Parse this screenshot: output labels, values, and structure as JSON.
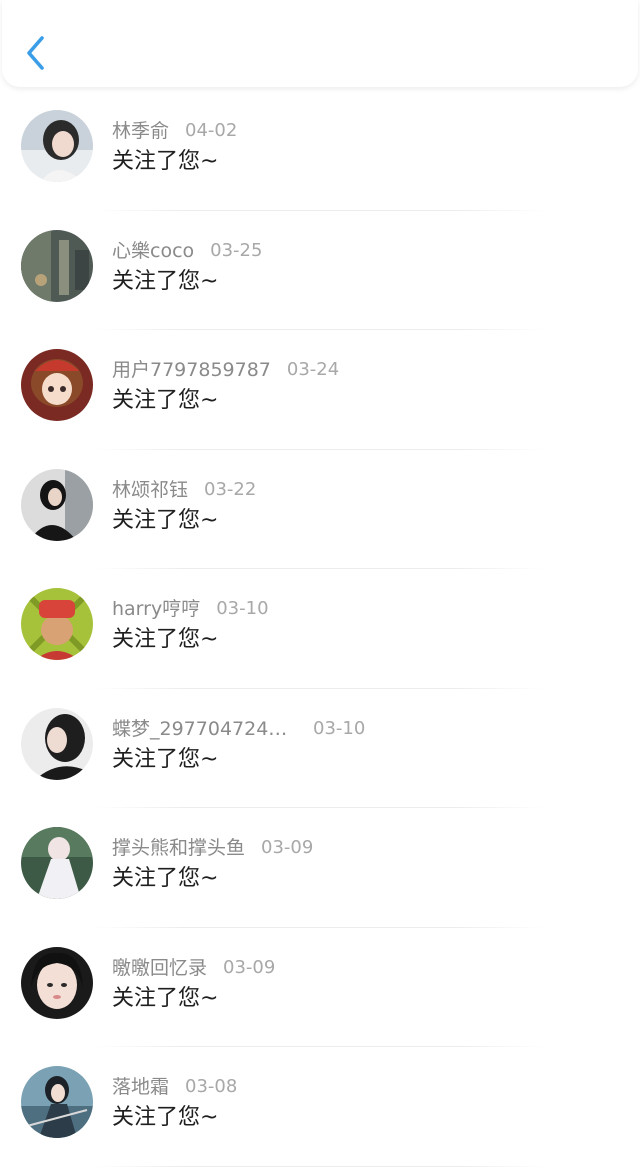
{
  "header": {
    "back_icon": "chevron-left-icon",
    "accent": "#3a9de8"
  },
  "notifications": [
    {
      "username": "林季俞",
      "date": "04-02",
      "message": "关注了您~",
      "avatar": "avatar-icon"
    },
    {
      "username": "心樂coco",
      "date": "03-25",
      "message": "关注了您~",
      "avatar": "avatar-icon"
    },
    {
      "username": "用户7797859787",
      "date": "03-24",
      "message": "关注了您~",
      "avatar": "avatar-icon"
    },
    {
      "username": "林颂祁钰",
      "date": "03-22",
      "message": "关注了您~",
      "avatar": "avatar-icon"
    },
    {
      "username": "harry哼哼",
      "date": "03-10",
      "message": "关注了您~",
      "avatar": "avatar-icon"
    },
    {
      "username": "蝶梦_2977047240...",
      "date": "03-10",
      "message": "关注了您~",
      "avatar": "avatar-icon"
    },
    {
      "username": "撑头熊和撑头鱼",
      "date": "03-09",
      "message": "关注了您~",
      "avatar": "avatar-icon"
    },
    {
      "username": "曒曒回忆录",
      "date": "03-09",
      "message": "关注了您~",
      "avatar": "avatar-icon"
    },
    {
      "username": "落地霜",
      "date": "03-08",
      "message": "关注了您~",
      "avatar": "avatar-icon"
    }
  ]
}
